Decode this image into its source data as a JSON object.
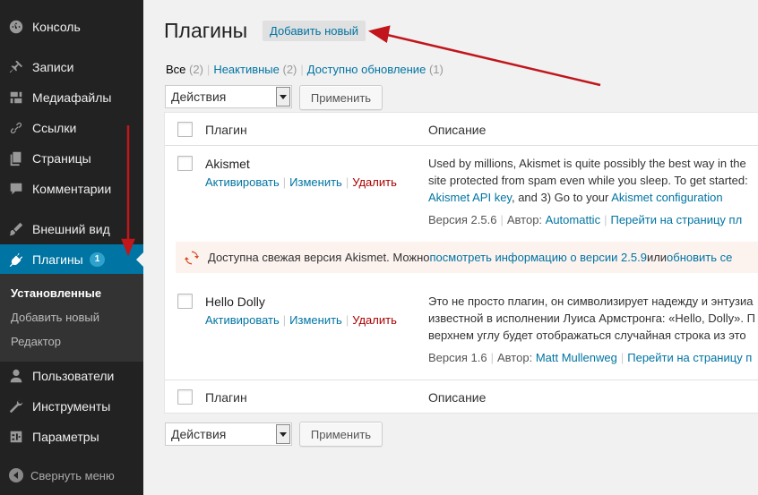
{
  "sidebar": {
    "items": [
      {
        "label": "Консоль",
        "icon": "dashboard-icon"
      },
      {
        "label": "Записи",
        "icon": "pin-icon"
      },
      {
        "label": "Медиафайлы",
        "icon": "media-icon"
      },
      {
        "label": "Ссылки",
        "icon": "link-icon"
      },
      {
        "label": "Страницы",
        "icon": "pages-icon"
      },
      {
        "label": "Комментарии",
        "icon": "comment-icon"
      },
      {
        "label": "Внешний вид",
        "icon": "brush-icon"
      },
      {
        "label": "Плагины",
        "icon": "plugin-icon",
        "badge": "1"
      },
      {
        "label": "Пользователи",
        "icon": "user-icon"
      },
      {
        "label": "Инструменты",
        "icon": "wrench-icon"
      },
      {
        "label": "Параметры",
        "icon": "settings-icon"
      }
    ],
    "submenu": [
      "Установленные",
      "Добавить новый",
      "Редактор"
    ],
    "collapse_label": "Свернуть меню"
  },
  "page": {
    "title": "Плагины",
    "add_new": "Добавить новый"
  },
  "filters": {
    "all": "Все",
    "all_count": "(2)",
    "inactive": "Неактивные",
    "inactive_count": "(2)",
    "updates": "Доступно обновление",
    "updates_count": "(1)"
  },
  "bulk": {
    "select_label": "Действия",
    "apply_label": "Применить"
  },
  "table": {
    "col_plugin": "Плагин",
    "col_desc": "Описание",
    "rows": [
      {
        "name": "Akismet",
        "activate": "Активировать",
        "edit": "Изменить",
        "delete": "Удалить",
        "desc1": "Used by millions, Akismet is quite possibly the best way in the",
        "desc2": "site protected from spam even while you sleep. To get started:",
        "desc3a": "Akismet API key",
        "desc3b": ", and 3) Go to your ",
        "desc3c": "Akismet configuration",
        "version": "Версия 2.5.6",
        "author_label": "Автор:",
        "author": "Automattic",
        "site_link": "Перейти на страницу пл"
      },
      {
        "name": "Hello Dolly",
        "activate": "Активировать",
        "edit": "Изменить",
        "delete": "Удалить",
        "desc1": "Это не просто плагин, он символизирует надежду и энтузиа",
        "desc2": "известной в исполнении Луиса Армстронга: «Hello, Dolly». П",
        "desc3": "верхнем углу будет отображаться случайная строка из это",
        "version": "Версия 1.6",
        "author_label": "Автор:",
        "author": "Matt Mullenweg",
        "site_link": "Перейти на страницу п"
      }
    ],
    "update_notice": {
      "text": "Доступна свежая версия Akismet. Можно ",
      "link1": "посмотреть информацию о версии 2.5.9",
      "or": " или ",
      "link2": "обновить се"
    }
  }
}
